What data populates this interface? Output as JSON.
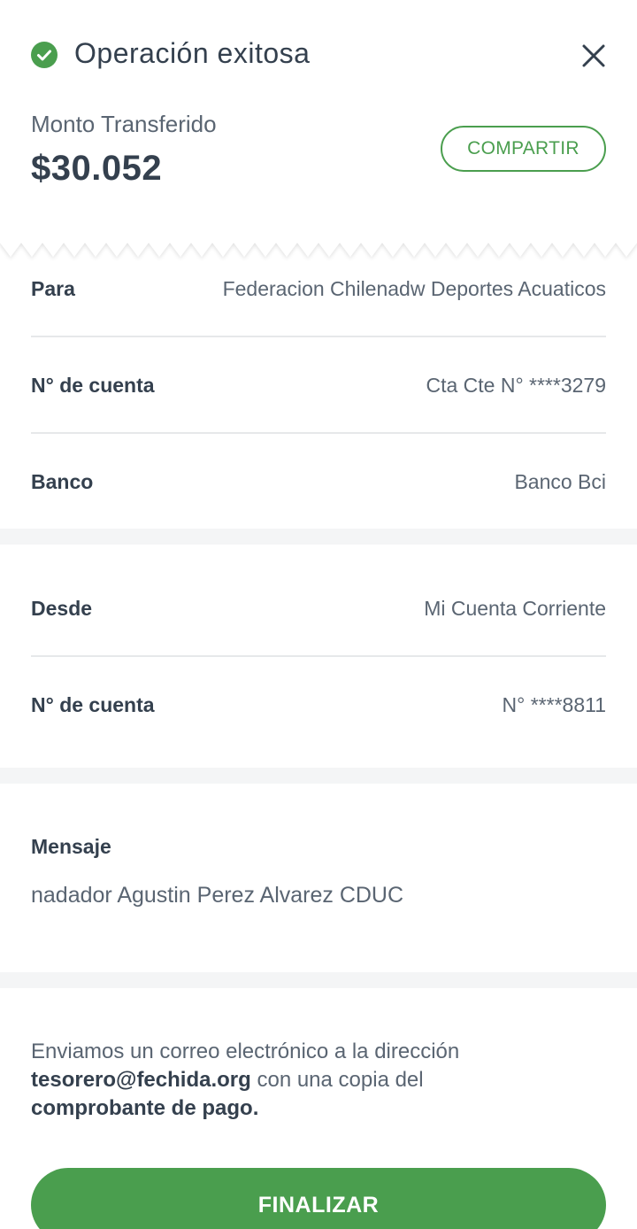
{
  "header": {
    "title": "Operación exitosa",
    "amount_label": "Monto Transferido",
    "amount": "$30.052",
    "share_label": "COMPARTIR"
  },
  "recipient": {
    "para_label": "Para",
    "para_value": "Federacion Chilenadw Deportes Acuaticos",
    "account_label": "N° de cuenta",
    "account_value": "Cta Cte N° ****3279",
    "bank_label": "Banco",
    "bank_value": "Banco Bci"
  },
  "origin": {
    "desde_label": "Desde",
    "desde_value": "Mi Cuenta Corriente",
    "account_label": "N° de cuenta",
    "account_value": "N° ****8811"
  },
  "message": {
    "label": "Mensaje",
    "text": "nadador Agustin Perez Alvarez CDUC"
  },
  "notice": {
    "prefix": "Enviamos un correo electrónico a la dirección",
    "email": "tesorero@fechida.org",
    "middle": "con una copia del",
    "doc": "comprobante de pago."
  },
  "footer": {
    "finish_label": "FINALIZAR"
  },
  "colors": {
    "accent": "#4a9e4e",
    "text_dark": "#34404e",
    "text_muted": "#5a6572",
    "band": "#f4f5f6"
  },
  "icons": {
    "status": "check-circle-icon",
    "close": "close-icon"
  }
}
